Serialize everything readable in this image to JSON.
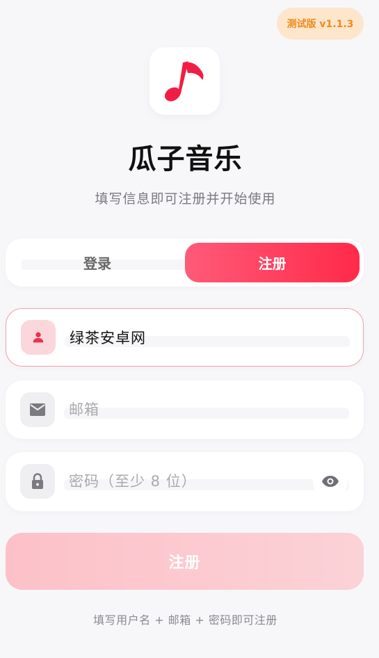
{
  "version_badge": "测试版 v1.1.3",
  "app": {
    "title": "瓜子音乐",
    "subtitle": "填写信息即可注册并开始使用",
    "logo_icon": "music-note-icon",
    "accent_color": "#ff2a49"
  },
  "tabs": {
    "login": "登录",
    "register": "注册",
    "active": "register"
  },
  "form": {
    "username": {
      "value": "绿茶安卓网",
      "placeholder": "",
      "icon": "person-icon"
    },
    "email": {
      "value": "",
      "placeholder": "邮箱",
      "icon": "mail-icon"
    },
    "password": {
      "value": "",
      "placeholder": "密码（至少 8 位）",
      "icon": "lock-icon",
      "toggle_icon": "eye-icon"
    },
    "submit_label": "注册"
  },
  "footer_hint": "填写用户名 + 邮箱 + 密码即可注册"
}
